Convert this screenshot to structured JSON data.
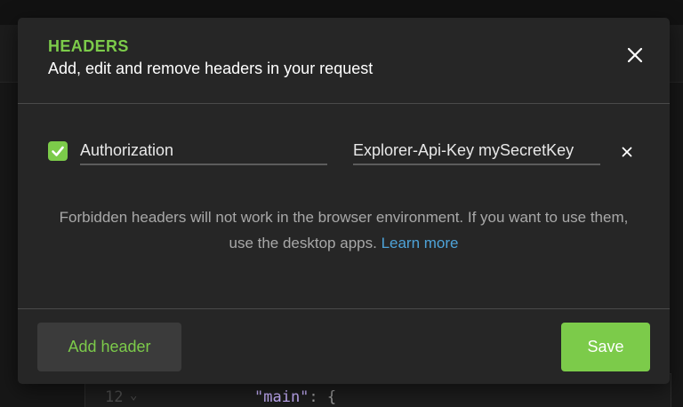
{
  "background": {
    "code_line_number": "12",
    "code_key": "\"main\"",
    "code_punct": ": {"
  },
  "modal": {
    "title": "HEADERS",
    "subtitle": "Add, edit and remove headers in your request",
    "close_icon": "close-icon",
    "headers": [
      {
        "enabled": true,
        "key": "Authorization",
        "value": "Explorer-Api-Key mySecretKey",
        "remove_icon": "close-icon"
      }
    ],
    "notice": {
      "text": "Forbidden headers will not work in the browser environment. If you want to use them, use the desktop apps.",
      "link_label": "Learn more"
    },
    "add_header_label": "Add header",
    "save_label": "Save"
  },
  "colors": {
    "accent": "#7ccb4a",
    "link": "#4ea3d8",
    "modal_bg": "#262626",
    "page_bg": "#171717"
  }
}
